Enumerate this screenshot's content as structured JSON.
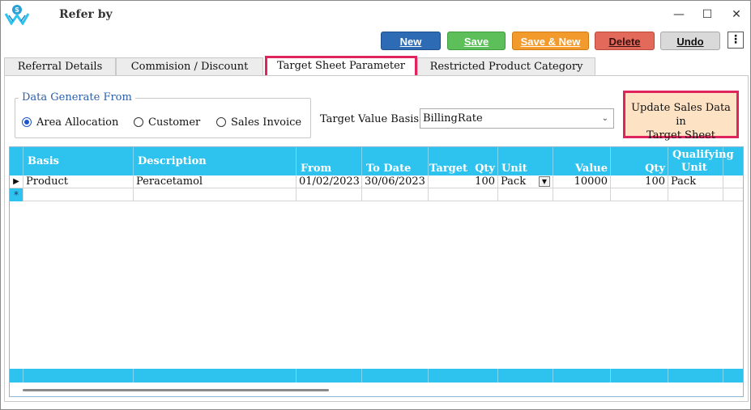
{
  "window": {
    "title": "Refer by",
    "minimize_glyph": "—",
    "maximize_glyph": "☐",
    "close_glyph": "✕"
  },
  "toolbar": {
    "new_label": "New",
    "save_label": "Save",
    "save_new_label": "Save & New",
    "delete_label": "Delete",
    "undo_label": "Undo",
    "more_glyph": "⋮",
    "colors": {
      "new": "#2d6cb5",
      "save": "#5cbf5a",
      "save_new": "#f39a2d",
      "delete": "#e36a5a",
      "undo": "#d9d9d9"
    }
  },
  "tabs": [
    {
      "label": "Referral Details",
      "active": false
    },
    {
      "label": "Commision / Discount",
      "active": false
    },
    {
      "label": "Target Sheet Parameter",
      "active": true
    },
    {
      "label": "Restricted Product Category",
      "active": false
    }
  ],
  "data_generate": {
    "legend": "Data Generate From",
    "options": [
      {
        "label": "Area Allocation",
        "selected": true
      },
      {
        "label": "Customer",
        "selected": false
      },
      {
        "label": "Sales Invoice",
        "selected": false
      }
    ]
  },
  "target_value_basis": {
    "label": "Target Value Basis",
    "value": "BillingRate"
  },
  "update_button": {
    "line1": "Update Sales Data in",
    "line2": "Target Sheet"
  },
  "grid": {
    "header_color": "#2ec2ee",
    "columns": {
      "basis": "Basis",
      "description": "Description",
      "from_date": "From Date",
      "to_date": "To Date",
      "target_qty": "Target  Qty",
      "unit": "Unit",
      "value": "Value",
      "qty": "Qty",
      "qualifying_unit_line1": "Qualifying",
      "qualifying_unit_line2": "Unit"
    },
    "rows": [
      {
        "basis": "Product",
        "description": "Peracetamol",
        "from_date": "01/02/2023",
        "to_date": "30/06/2023",
        "target_qty": "100",
        "unit": "Pack",
        "value": "10000",
        "qty": "100",
        "qualifying_unit": "Pack"
      }
    ],
    "current_row_marker": "▶",
    "new_row_marker": "*"
  }
}
